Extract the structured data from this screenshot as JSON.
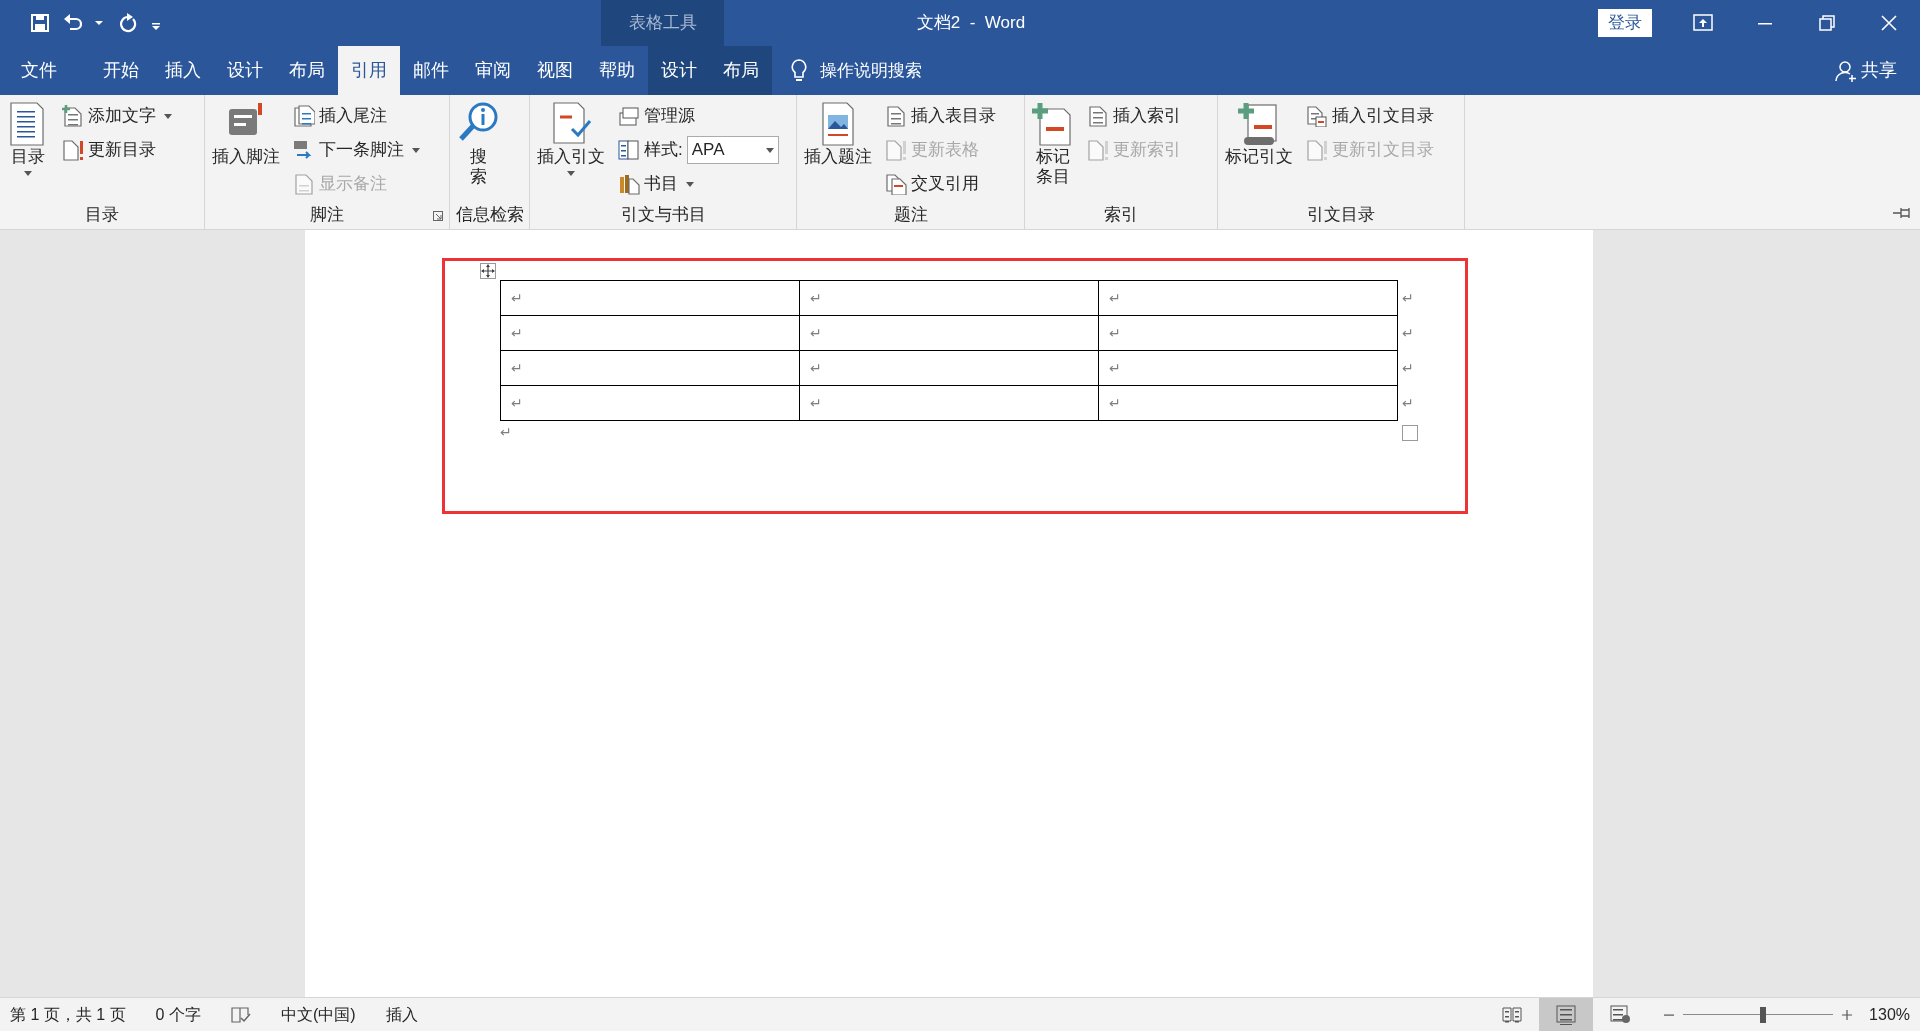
{
  "window": {
    "title": "文档2  -  Word",
    "context_label": "表格工具",
    "login": "登录"
  },
  "tabs": [
    {
      "label": "文件",
      "selected": false,
      "kind": "file"
    },
    {
      "label": "开始",
      "selected": false,
      "kind": "main"
    },
    {
      "label": "插入",
      "selected": false,
      "kind": "main"
    },
    {
      "label": "设计",
      "selected": false,
      "kind": "main"
    },
    {
      "label": "布局",
      "selected": false,
      "kind": "main"
    },
    {
      "label": "引用",
      "selected": true,
      "kind": "main"
    },
    {
      "label": "邮件",
      "selected": false,
      "kind": "main"
    },
    {
      "label": "审阅",
      "selected": false,
      "kind": "main"
    },
    {
      "label": "视图",
      "selected": false,
      "kind": "main"
    },
    {
      "label": "帮助",
      "selected": false,
      "kind": "main"
    },
    {
      "label": "设计",
      "selected": false,
      "kind": "context"
    },
    {
      "label": "布局",
      "selected": false,
      "kind": "context"
    }
  ],
  "tell_me": {
    "placeholder": "操作说明搜索"
  },
  "share": "共享",
  "ribbon": {
    "groups": [
      {
        "label": "目录",
        "launcher": false,
        "large": [
          {
            "label": "目录",
            "kind": "tall",
            "dropdown": true
          }
        ],
        "small": [
          {
            "label": "添加文字",
            "disabled": false,
            "dropdown": true
          },
          {
            "label": "更新目录",
            "disabled": false,
            "dropdown": false
          }
        ]
      },
      {
        "label": "脚注",
        "launcher": true,
        "large": [
          {
            "label": "插入脚注",
            "kind": "wide",
            "dropdown": false
          }
        ],
        "small": [
          {
            "label": "插入尾注",
            "disabled": false,
            "dropdown": false
          },
          {
            "label": "下一条脚注",
            "disabled": false,
            "dropdown": true
          },
          {
            "label": "显示备注",
            "disabled": true,
            "dropdown": false
          }
        ]
      },
      {
        "label": "信息检索",
        "launcher": false,
        "large": [
          {
            "label": "搜索",
            "kind": "tall",
            "dropdown": false
          }
        ]
      },
      {
        "label": "引文与书目",
        "launcher": false,
        "large": [
          {
            "label": "插入引文",
            "kind": "wide",
            "dropdown": true
          }
        ],
        "small": [
          {
            "label": "管理源",
            "disabled": false,
            "dropdown": false
          },
          {
            "label": "样式:",
            "value": "APA"
          },
          {
            "label": "书目",
            "disabled": false,
            "dropdown": true
          }
        ]
      },
      {
        "label": "题注",
        "launcher": false,
        "large": [
          {
            "label": "插入题注",
            "kind": "wide",
            "dropdown": false
          }
        ],
        "small": [
          {
            "label": "插入表目录",
            "disabled": false,
            "dropdown": false
          },
          {
            "label": "更新表格",
            "disabled": true,
            "dropdown": false
          },
          {
            "label": "交叉引用",
            "disabled": false,
            "dropdown": false
          }
        ]
      },
      {
        "label": "索引",
        "launcher": false,
        "large": [
          {
            "label": "标记条目",
            "kind": "tall",
            "dropdown": false
          }
        ],
        "small": [
          {
            "label": "插入索引",
            "disabled": false,
            "dropdown": false
          },
          {
            "label": "更新索引",
            "disabled": true,
            "dropdown": false
          }
        ]
      },
      {
        "label": "引文目录",
        "launcher": false,
        "large": [
          {
            "label": "标记引文",
            "kind": "wide",
            "dropdown": false
          }
        ],
        "small": [
          {
            "label": "插入引文目录",
            "disabled": false,
            "dropdown": false
          },
          {
            "label": "更新引文目录",
            "disabled": true,
            "dropdown": false
          }
        ]
      }
    ]
  },
  "document": {
    "table": {
      "rows": [
        [
          "↵",
          "↵",
          "↵"
        ],
        [
          "↵",
          "↵",
          "↵"
        ],
        [
          "↵",
          "↵",
          "↵"
        ],
        [
          "↵",
          "↵",
          "↵"
        ]
      ],
      "row_marks": [
        "↵",
        "↵",
        "↵",
        "↵"
      ]
    },
    "paragraph_mark": "↵"
  },
  "status_bar": {
    "page": "第 1 页，共 1 页",
    "words": "0 个字",
    "language": "中文(中国)",
    "mode": "插入",
    "views": [
      {
        "selected": false
      },
      {
        "selected": true
      },
      {
        "selected": false
      }
    ],
    "zoom": {
      "level": 0.53,
      "reading": "130%"
    }
  }
}
